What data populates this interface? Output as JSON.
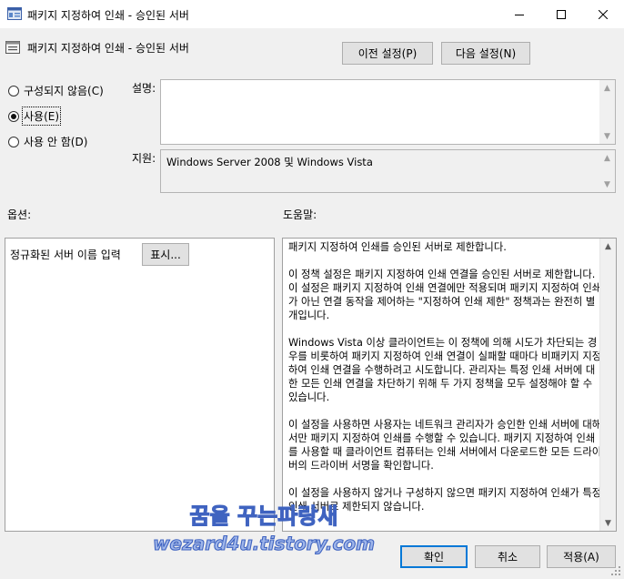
{
  "window": {
    "title": "패키지 지정하여 인쇄 - 승인된 서버",
    "minimize_glyph": "—",
    "maximize_glyph": "☐",
    "close_glyph": "✕"
  },
  "header": {
    "policy_title": "패키지 지정하여 인쇄 - 승인된 서버",
    "prev_label": "이전 설정(P)",
    "next_label": "다음 설정(N)"
  },
  "state": {
    "options": [
      {
        "label": "구성되지 않음(C)",
        "selected": false
      },
      {
        "label": "사용(E)",
        "selected": true
      },
      {
        "label": "사용 안 함(D)",
        "selected": false
      }
    ]
  },
  "comment": {
    "label": "설명:",
    "value": ""
  },
  "supported": {
    "label": "지원:",
    "value": "Windows Server 2008 및 Windows Vista"
  },
  "options_panel": {
    "label": "옵션:",
    "server_label": "정규화된 서버 이름 입력",
    "show_button": "표시..."
  },
  "help_panel": {
    "label": "도움말:",
    "paragraphs": [
      "패키지 지정하여 인쇄를 승인된 서버로 제한합니다.",
      "이 정책 설정은 패키지 지정하여 인쇄 연결을 승인된 서버로 제한합니다. 이 설정은 패키지 지정하여 인쇄 연결에만 적용되며 패키지 지정하여 인쇄가 아닌 연결 동작을 제어하는 \"지정하여 인쇄 제한\" 정책과는 완전히 별개입니다.",
      "Windows Vista 이상 클라이언트는 이 정책에 의해 시도가 차단되는 경우를 비롯하여 패키지 지정하여 인쇄 연결이 실패할 때마다 비패키지 지정하여 인쇄 연결을 수행하려고 시도합니다. 관리자는 특정 인쇄 서버에 대한 모든 인쇄 연결을 차단하기 위해 두 가지 정책을 모두 설정해야 할 수 있습니다.",
      "이 설정을 사용하면 사용자는 네트워크 관리자가 승인한 인쇄 서버에 대해서만 패키지 지정하여 인쇄를 수행할 수 있습니다. 패키지 지정하여 인쇄를 사용할 때 클라이언트 컴퓨터는 인쇄 서버에서 다운로드한 모든 드라이버의 드라이버 서명을 확인합니다.",
      "이 설정을 사용하지 않거나 구성하지 않으면 패키지 지정하여 인쇄가 특정 인쇄 서버로 제한되지 않습니다."
    ]
  },
  "footer": {
    "ok": "확인",
    "cancel": "취소",
    "apply": "적용(A)"
  },
  "watermark": {
    "line1": "꿈을 꾸는파랑새",
    "line2": "wezard4u.tistory.com"
  },
  "colors": {
    "accent": "#0078d7",
    "watermark_fill": "#9fb6ea",
    "watermark_stroke": "#3f63c0"
  }
}
